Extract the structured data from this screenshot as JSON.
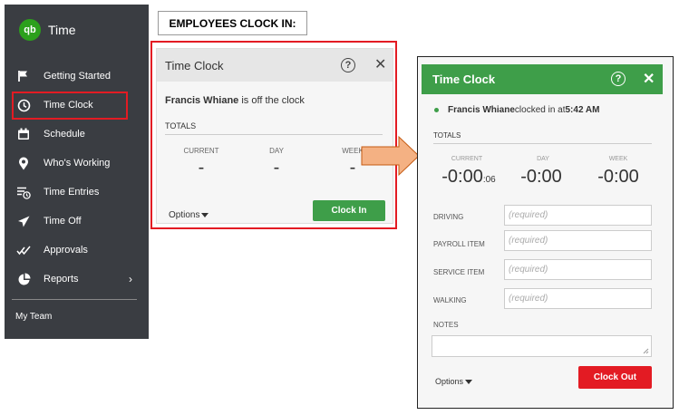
{
  "sidebar": {
    "brand_logo": "qb",
    "brand_name": "Time",
    "items": [
      {
        "label": "Getting Started",
        "icon": "flag-icon"
      },
      {
        "label": "Time Clock",
        "icon": "clock-icon"
      },
      {
        "label": "Schedule",
        "icon": "calendar-icon"
      },
      {
        "label": "Who's Working",
        "icon": "location-pin-icon"
      },
      {
        "label": "Time Entries",
        "icon": "list-clock-icon"
      },
      {
        "label": "Time Off",
        "icon": "airplane-icon"
      },
      {
        "label": "Approvals",
        "icon": "double-check-icon"
      },
      {
        "label": "Reports",
        "icon": "pie-chart-icon",
        "chevron": "›"
      }
    ],
    "my_team": "My Team"
  },
  "heading": "EMPLOYEES CLOCK IN:",
  "clock_before": {
    "title": "Time Clock",
    "employee": "Francis Whiane",
    "status": " is off the clock",
    "totals_label": "TOTALS",
    "columns": [
      {
        "label": "CURRENT",
        "value": "-"
      },
      {
        "label": "DAY",
        "value": "-"
      },
      {
        "label": "WEEK",
        "value": "-"
      }
    ],
    "options_label": "Options",
    "action_label": "Clock In"
  },
  "clock_after": {
    "title": "Time Clock",
    "employee": "Francis Whiane",
    "status": " clocked in at ",
    "time": "5:42 AM",
    "totals_label": "TOTALS",
    "columns": [
      {
        "label": "CURRENT",
        "value": "-0:00",
        "seconds": ":06"
      },
      {
        "label": "DAY",
        "value": "-0:00"
      },
      {
        "label": "WEEK",
        "value": "-0:00"
      }
    ],
    "fields": [
      {
        "label": "DRIVING",
        "placeholder": "(required)"
      },
      {
        "label": "PAYROLL ITEM",
        "placeholder": "(required)"
      },
      {
        "label": "SERVICE ITEM",
        "placeholder": "(required)"
      },
      {
        "label": "WALKING",
        "placeholder": "(required)"
      }
    ],
    "notes_label": "NOTES",
    "options_label": "Options",
    "action_label": "Clock Out"
  },
  "colors": {
    "sidebar_bg": "#3a3d42",
    "brand_green": "#2ca01c",
    "action_green": "#3e9e49",
    "action_red": "#e31b23",
    "highlight": "#e31b23",
    "arrow_fill": "#f4b183"
  }
}
